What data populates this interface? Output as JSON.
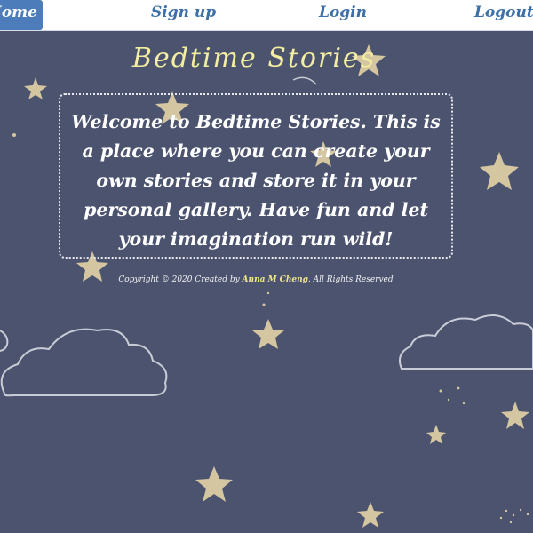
{
  "nav": {
    "home": "Home",
    "signup": "Sign up",
    "login": "Login",
    "logout": "Logout"
  },
  "title": "Bedtime Stories",
  "welcome": "Welcome to Bedtime Stories. This is a place where you can create your own stories and store it in your personal gallery. Have fun and let your imagination run wild!",
  "footer": {
    "prefix": "Copyright © 2020 Created by",
    "author": "Anna M Cheng",
    "suffix": ". All Rights Reserved"
  },
  "colors": {
    "background": "#4b536e",
    "nav_link": "#3d6fa8",
    "nav_active": "#4c7cb9",
    "title": "#f3eea0",
    "star": "#d4c6a0",
    "cloud_outline": "#c8ccd6",
    "author": "#f0e68c"
  }
}
